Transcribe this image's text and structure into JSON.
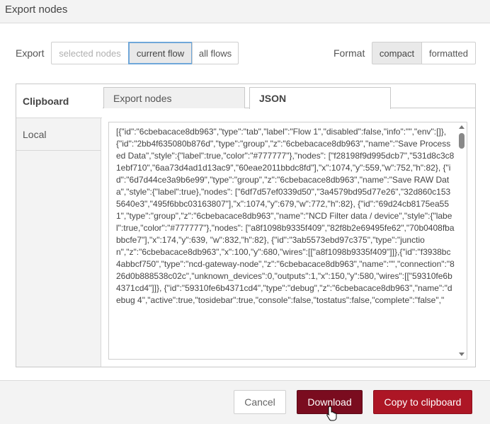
{
  "dialog": {
    "title": "Export nodes"
  },
  "export_row": {
    "label": "Export",
    "options": [
      "selected nodes",
      "current flow",
      "all flows"
    ],
    "selected": "current flow"
  },
  "format_row": {
    "label": "Format",
    "options": [
      "compact",
      "formatted"
    ],
    "selected": "compact"
  },
  "side_tabs": {
    "clipboard": "Clipboard",
    "local": "Local"
  },
  "content_tabs": {
    "export_nodes": "Export nodes",
    "json": "JSON"
  },
  "json_text": "[{\"id\":\"6cbebacace8db963\",\"type\":\"tab\",\"label\":\"Flow 1\",\"disabled\":false,\"info\":\"\",\"env\":[]}, {\"id\":\"2bb4f635080b876d\",\"type\":\"group\",\"z\":\"6cbebacace8db963\",\"name\":\"Save Processed Data\",\"style\":{\"label\":true,\"color\":\"#777777\"},\"nodes\": [\"f28198f9d995dcb7\",\"531d8c3c81ebf710\",\"6aa73d4ad1d13ac9\",\"60eae2011bbdc8fd\"],\"x\":1074,\"y\":559,\"w\":752,\"h\":82}, {\"id\":\"6d7d44ce3a9b6e99\",\"type\":\"group\",\"z\":\"6cbebacace8db963\",\"name\":\"Save RAW Data\",\"style\":{\"label\":true},\"nodes\": [\"6df7d57ef0339d50\",\"3a4579bd95d77e26\",\"32d860c1535640e3\",\"495f6bbc03163807\"],\"x\":1074,\"y\":679,\"w\":772,\"h\":82}, {\"id\":\"69d24cb8175ea551\",\"type\":\"group\",\"z\":\"6cbebacace8db963\",\"name\":\"NCD Filter data / device\",\"style\":{\"label\":true,\"color\":\"#777777\"},\"nodes\": [\"a8f1098b9335f409\",\"82f8b2e69495fe62\",\"70b0408fbabbcfe7\"],\"x\":174,\"y\":639, \"w\":832,\"h\":82}, {\"id\":\"3ab5573ebd97c375\",\"type\":\"junction\",\"z\":\"6cbebacace8db963\",\"x\":100,\"y\":680,\"wires\":[[\"a8f1098b9335f409\"]]},{\"id\":\"f3938bc4abbcf750\",\"type\":\"ncd-gateway-node\",\"z\":\"6cbebacace8db963\",\"name\":\"\",\"connection\":\"826d0b888538c02c\",\"unknown_devices\":0,\"outputs\":1,\"x\":150,\"y\":580,\"wires\":[[\"59310fe6b4371cd4\"]]}, {\"id\":\"59310fe6b4371cd4\",\"type\":\"debug\",\"z\":\"6cbebacace8db963\",\"name\":\"debug 4\",\"active\":true,\"tosidebar\":true,\"console\":false,\"tostatus\":false,\"complete\":\"false\",\"",
  "buttons": {
    "cancel": "Cancel",
    "download": "Download",
    "copy": "Copy to clipboard"
  }
}
